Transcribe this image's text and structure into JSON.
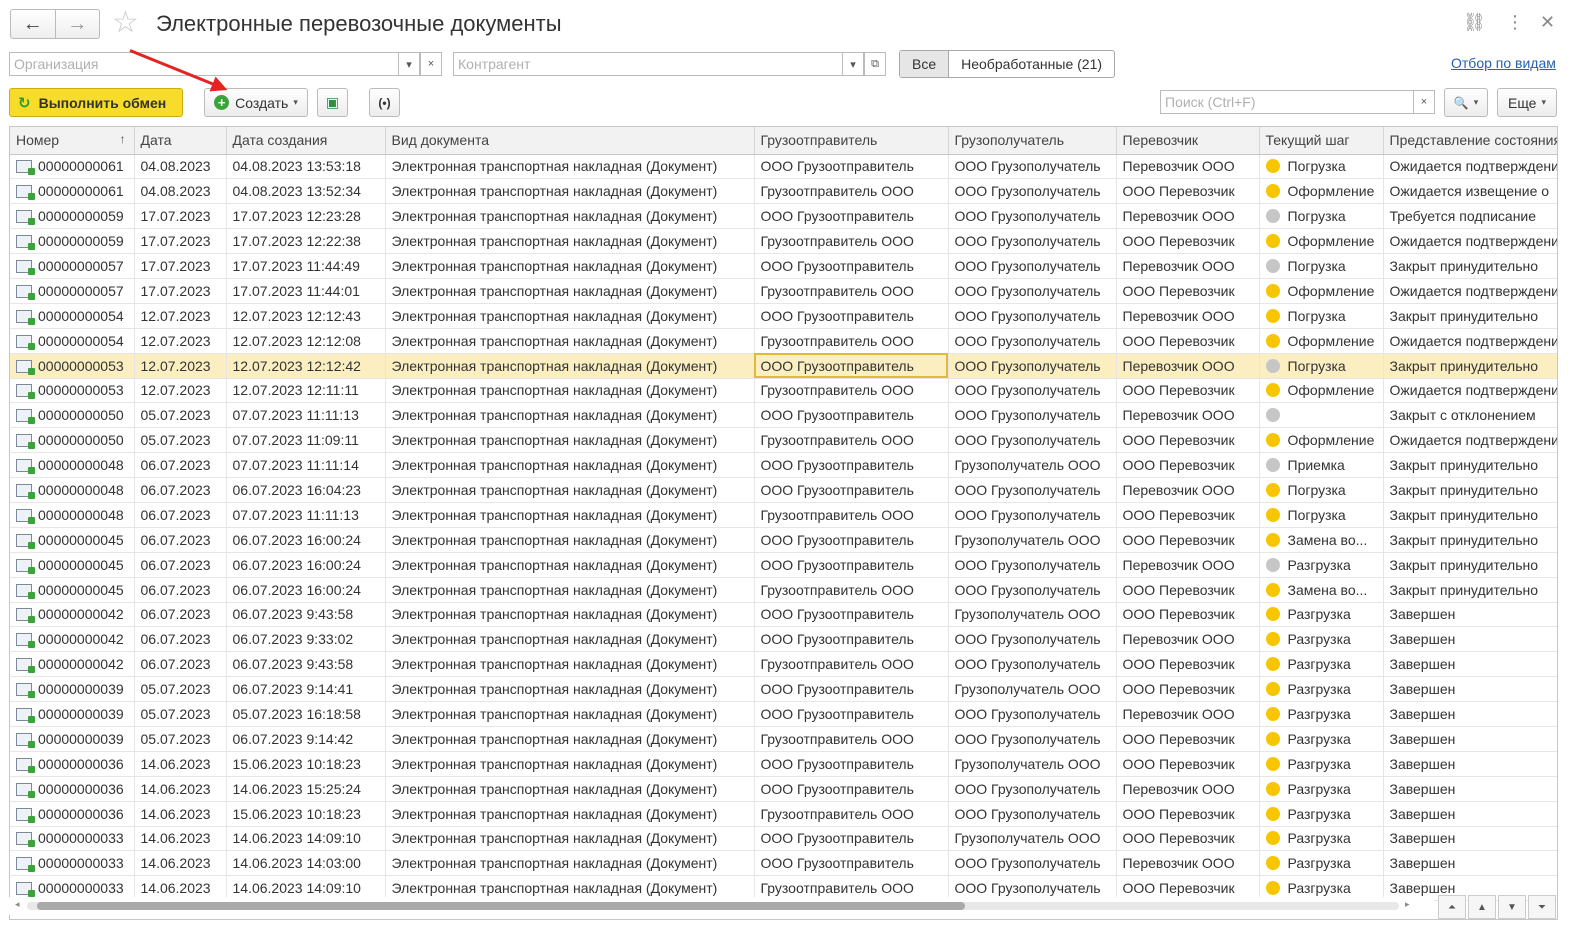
{
  "window": {
    "title": "Электронные перевозочные документы",
    "back_icon": "←",
    "forward_icon": "→",
    "star_icon": "☆",
    "link_icon": "⛓",
    "more_icon": "⋮",
    "close_icon": "✕"
  },
  "filters": {
    "organization_placeholder": "Организация",
    "counterparty_placeholder": "Контрагент",
    "dropdown_glyph": "▾",
    "clear_glyph": "×",
    "open_glyph": "⧉",
    "seg_all": "Все",
    "seg_unprocessed": "Необработанные (21)",
    "kind_filter_link": "Отбор по видам"
  },
  "toolbar": {
    "exchange_label": "Выполнить обмен",
    "exchange_icon": "↻",
    "create_label": "Создать",
    "create_icon": "+",
    "caret": "▾",
    "doc_icon": "▣",
    "signal_icon": "(•)",
    "search_placeholder": "Поиск (Ctrl+F)",
    "search_clear": "×",
    "search_icon": "🔍",
    "more_label": "Еще"
  },
  "colors": {
    "yellow": "#f7c600",
    "gray": "#c6c6c6"
  },
  "table": {
    "columns": [
      "Номер",
      "Дата",
      "Дата создания",
      "Вид документа",
      "Грузоотправитель",
      "Грузополучатель",
      "Перевозчик",
      "Текущий шаг",
      "Представление состояния"
    ],
    "sort_indicator": "↑",
    "rows": [
      {
        "num": "00000000061",
        "date": "04.08.2023",
        "created": "04.08.2023 13:53:18",
        "kind": "Электронная транспортная накладная (Документ)",
        "shipper": "ООО Грузоотправитель",
        "consignee": "ООО Грузополучатель",
        "carrier": "Перевозчик ООО",
        "status": "yellow",
        "step": "Погрузка",
        "state": "Ожидается подтверждение"
      },
      {
        "num": "00000000061",
        "date": "04.08.2023",
        "created": "04.08.2023 13:52:34",
        "kind": "Электронная транспортная накладная (Документ)",
        "shipper": "Грузоотправитель ООО",
        "consignee": "ООО Грузополучатель",
        "carrier": "ООО Перевозчик",
        "status": "yellow",
        "step": "Оформление",
        "state": "Ожидается извещение о"
      },
      {
        "num": "00000000059",
        "date": "17.07.2023",
        "created": "17.07.2023 12:23:28",
        "kind": "Электронная транспортная накладная (Документ)",
        "shipper": "ООО Грузоотправитель",
        "consignee": "ООО Грузополучатель",
        "carrier": "Перевозчик ООО",
        "status": "gray",
        "step": "Погрузка",
        "state": "Требуется подписание"
      },
      {
        "num": "00000000059",
        "date": "17.07.2023",
        "created": "17.07.2023 12:22:38",
        "kind": "Электронная транспортная накладная (Документ)",
        "shipper": "Грузоотправитель ООО",
        "consignee": "ООО Грузополучатель",
        "carrier": "ООО Перевозчик",
        "status": "yellow",
        "step": "Оформление",
        "state": "Ожидается подтверждение"
      },
      {
        "num": "00000000057",
        "date": "17.07.2023",
        "created": "17.07.2023 11:44:49",
        "kind": "Электронная транспортная накладная (Документ)",
        "shipper": "ООО Грузоотправитель",
        "consignee": "ООО Грузополучатель",
        "carrier": "Перевозчик ООО",
        "status": "gray",
        "step": "Погрузка",
        "state": "Закрыт принудительно"
      },
      {
        "num": "00000000057",
        "date": "17.07.2023",
        "created": "17.07.2023 11:44:01",
        "kind": "Электронная транспортная накладная (Документ)",
        "shipper": "Грузоотправитель ООО",
        "consignee": "ООО Грузополучатель",
        "carrier": "ООО Перевозчик",
        "status": "yellow",
        "step": "Оформление",
        "state": "Ожидается подтверждение"
      },
      {
        "num": "00000000054",
        "date": "12.07.2023",
        "created": "12.07.2023 12:12:43",
        "kind": "Электронная транспортная накладная (Документ)",
        "shipper": "ООО Грузоотправитель",
        "consignee": "ООО Грузополучатель",
        "carrier": "Перевозчик ООО",
        "status": "yellow",
        "step": "Погрузка",
        "state": "Закрыт принудительно"
      },
      {
        "num": "00000000054",
        "date": "12.07.2023",
        "created": "12.07.2023 12:12:08",
        "kind": "Электронная транспортная накладная (Документ)",
        "shipper": "Грузоотправитель ООО",
        "consignee": "ООО Грузополучатель",
        "carrier": "ООО Перевозчик",
        "status": "yellow",
        "step": "Оформление",
        "state": "Ожидается подтверждение"
      },
      {
        "num": "00000000053",
        "date": "12.07.2023",
        "created": "12.07.2023 12:12:42",
        "kind": "Электронная транспортная накладная (Документ)",
        "shipper": "ООО Грузоотправитель",
        "consignee": "ООО Грузополучатель",
        "carrier": "Перевозчик ООО",
        "status": "gray",
        "step": "Погрузка",
        "state": "Закрыт принудительно"
      },
      {
        "num": "00000000053",
        "date": "12.07.2023",
        "created": "12.07.2023 12:11:11",
        "kind": "Электронная транспортная накладная (Документ)",
        "shipper": "Грузоотправитель ООО",
        "consignee": "ООО Грузополучатель",
        "carrier": "ООО Перевозчик",
        "status": "yellow",
        "step": "Оформление",
        "state": "Ожидается подтверждение"
      },
      {
        "num": "00000000050",
        "date": "05.07.2023",
        "created": "07.07.2023 11:11:13",
        "kind": "Электронная транспортная накладная (Документ)",
        "shipper": "ООО Грузоотправитель",
        "consignee": "ООО Грузополучатель",
        "carrier": "Перевозчик ООО",
        "status": "gray",
        "step": "",
        "state": "Закрыт с отклонением"
      },
      {
        "num": "00000000050",
        "date": "05.07.2023",
        "created": "07.07.2023 11:09:11",
        "kind": "Электронная транспортная накладная (Документ)",
        "shipper": "Грузоотправитель ООО",
        "consignee": "ООО Грузополучатель",
        "carrier": "ООО Перевозчик",
        "status": "yellow",
        "step": "Оформление",
        "state": "Ожидается подтверждение"
      },
      {
        "num": "00000000048",
        "date": "06.07.2023",
        "created": "07.07.2023 11:11:14",
        "kind": "Электронная транспортная накладная (Документ)",
        "shipper": "ООО Грузоотправитель",
        "consignee": "Грузополучатель ООО",
        "carrier": "ООО Перевозчик",
        "status": "gray",
        "step": "Приемка",
        "state": "Закрыт принудительно"
      },
      {
        "num": "00000000048",
        "date": "06.07.2023",
        "created": "06.07.2023 16:04:23",
        "kind": "Электронная транспортная накладная (Документ)",
        "shipper": "ООО Грузоотправитель",
        "consignee": "ООО Грузополучатель",
        "carrier": "Перевозчик ООО",
        "status": "yellow",
        "step": "Погрузка",
        "state": "Закрыт принудительно"
      },
      {
        "num": "00000000048",
        "date": "06.07.2023",
        "created": "07.07.2023 11:11:13",
        "kind": "Электронная транспортная накладная (Документ)",
        "shipper": "Грузоотправитель ООО",
        "consignee": "ООО Грузополучатель",
        "carrier": "ООО Перевозчик",
        "status": "yellow",
        "step": "Погрузка",
        "state": "Закрыт принудительно"
      },
      {
        "num": "00000000045",
        "date": "06.07.2023",
        "created": "06.07.2023 16:00:24",
        "kind": "Электронная транспортная накладная (Документ)",
        "shipper": "ООО Грузоотправитель",
        "consignee": "Грузополучатель ООО",
        "carrier": "ООО Перевозчик",
        "status": "yellow",
        "step": "Замена во...",
        "state": "Закрыт принудительно"
      },
      {
        "num": "00000000045",
        "date": "06.07.2023",
        "created": "06.07.2023 16:00:24",
        "kind": "Электронная транспортная накладная (Документ)",
        "shipper": "ООО Грузоотправитель",
        "consignee": "ООО Грузополучатель",
        "carrier": "Перевозчик ООО",
        "status": "gray",
        "step": "Разгрузка",
        "state": "Закрыт принудительно"
      },
      {
        "num": "00000000045",
        "date": "06.07.2023",
        "created": "06.07.2023 16:00:24",
        "kind": "Электронная транспортная накладная (Документ)",
        "shipper": "Грузоотправитель ООО",
        "consignee": "ООО Грузополучатель",
        "carrier": "ООО Перевозчик",
        "status": "yellow",
        "step": "Замена во...",
        "state": "Закрыт принудительно"
      },
      {
        "num": "00000000042",
        "date": "06.07.2023",
        "created": "06.07.2023 9:43:58",
        "kind": "Электронная транспортная накладная (Документ)",
        "shipper": "ООО Грузоотправитель",
        "consignee": "Грузополучатель ООО",
        "carrier": "ООО Перевозчик",
        "status": "yellow",
        "step": "Разгрузка",
        "state": "Завершен"
      },
      {
        "num": "00000000042",
        "date": "06.07.2023",
        "created": "06.07.2023 9:33:02",
        "kind": "Электронная транспортная накладная (Документ)",
        "shipper": "ООО Грузоотправитель",
        "consignee": "ООО Грузополучатель",
        "carrier": "Перевозчик ООО",
        "status": "yellow",
        "step": "Разгрузка",
        "state": "Завершен"
      },
      {
        "num": "00000000042",
        "date": "06.07.2023",
        "created": "06.07.2023 9:43:58",
        "kind": "Электронная транспортная накладная (Документ)",
        "shipper": "Грузоотправитель ООО",
        "consignee": "ООО Грузополучатель",
        "carrier": "ООО Перевозчик",
        "status": "yellow",
        "step": "Разгрузка",
        "state": "Завершен"
      },
      {
        "num": "00000000039",
        "date": "05.07.2023",
        "created": "06.07.2023 9:14:41",
        "kind": "Электронная транспортная накладная (Документ)",
        "shipper": "ООО Грузоотправитель",
        "consignee": "Грузополучатель ООО",
        "carrier": "ООО Перевозчик",
        "status": "yellow",
        "step": "Разгрузка",
        "state": "Завершен"
      },
      {
        "num": "00000000039",
        "date": "05.07.2023",
        "created": "05.07.2023 16:18:58",
        "kind": "Электронная транспортная накладная (Документ)",
        "shipper": "ООО Грузоотправитель",
        "consignee": "ООО Грузополучатель",
        "carrier": "Перевозчик ООО",
        "status": "yellow",
        "step": "Разгрузка",
        "state": "Завершен"
      },
      {
        "num": "00000000039",
        "date": "05.07.2023",
        "created": "06.07.2023 9:14:42",
        "kind": "Электронная транспортная накладная (Документ)",
        "shipper": "Грузоотправитель ООО",
        "consignee": "ООО Грузополучатель",
        "carrier": "ООО Перевозчик",
        "status": "yellow",
        "step": "Разгрузка",
        "state": "Завершен"
      },
      {
        "num": "00000000036",
        "date": "14.06.2023",
        "created": "15.06.2023 10:18:23",
        "kind": "Электронная транспортная накладная (Документ)",
        "shipper": "ООО Грузоотправитель",
        "consignee": "Грузополучатель ООО",
        "carrier": "ООО Перевозчик",
        "status": "yellow",
        "step": "Разгрузка",
        "state": "Завершен"
      },
      {
        "num": "00000000036",
        "date": "14.06.2023",
        "created": "14.06.2023 15:25:24",
        "kind": "Электронная транспортная накладная (Документ)",
        "shipper": "ООО Грузоотправитель",
        "consignee": "ООО Грузополучатель",
        "carrier": "Перевозчик ООО",
        "status": "yellow",
        "step": "Разгрузка",
        "state": "Завершен"
      },
      {
        "num": "00000000036",
        "date": "14.06.2023",
        "created": "15.06.2023 10:18:23",
        "kind": "Электронная транспортная накладная (Документ)",
        "shipper": "Грузоотправитель ООО",
        "consignee": "ООО Грузополучатель",
        "carrier": "ООО Перевозчик",
        "status": "yellow",
        "step": "Разгрузка",
        "state": "Завершен"
      },
      {
        "num": "00000000033",
        "date": "14.06.2023",
        "created": "14.06.2023 14:09:10",
        "kind": "Электронная транспортная накладная (Документ)",
        "shipper": "ООО Грузоотправитель",
        "consignee": "Грузополучатель ООО",
        "carrier": "ООО Перевозчик",
        "status": "yellow",
        "step": "Разгрузка",
        "state": "Завершен"
      },
      {
        "num": "00000000033",
        "date": "14.06.2023",
        "created": "14.06.2023 14:03:00",
        "kind": "Электронная транспортная накладная (Документ)",
        "shipper": "ООО Грузоотправитель",
        "consignee": "ООО Грузополучатель",
        "carrier": "Перевозчик ООО",
        "status": "yellow",
        "step": "Разгрузка",
        "state": "Завершен"
      },
      {
        "num": "00000000033",
        "date": "14.06.2023",
        "created": "14.06.2023 14:09:10",
        "kind": "Электронная транспортная накладная (Документ)",
        "shipper": "Грузоотправитель ООО",
        "consignee": "ООО Грузополучатель",
        "carrier": "ООО Перевозчик",
        "status": "yellow",
        "step": "Разгрузка",
        "state": "Завершен"
      }
    ],
    "selected_row_index": 8,
    "focused_cell": "shipper"
  },
  "scroll": {
    "left_arrow": "◂",
    "right_arrow": "▸",
    "first_glyph": "⏶",
    "up_glyph": "▲",
    "down_glyph": "▼",
    "last_glyph": "⏷"
  }
}
